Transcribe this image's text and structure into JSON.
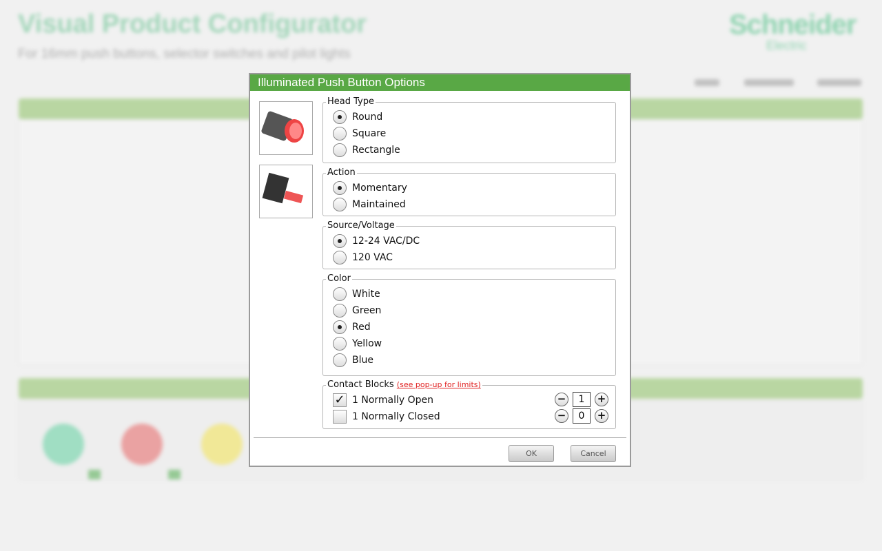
{
  "background": {
    "title": "Visual Product Configurator",
    "subtitle": "For 16mm push buttons, selector switches and pilot lights",
    "logo": "Schneider Electric"
  },
  "dialog": {
    "title": "Illuminated Push Button Options",
    "images": [
      "push-button-head-image",
      "contact-block-image"
    ],
    "head_type": {
      "legend": "Head Type",
      "options": [
        "Round",
        "Square",
        "Rectangle"
      ],
      "selected": "Round"
    },
    "action": {
      "legend": "Action",
      "options": [
        "Momentary",
        "Maintained"
      ],
      "selected": "Momentary"
    },
    "source_voltage": {
      "legend": "Source/Voltage",
      "options": [
        "12-24 VAC/DC",
        "120 VAC"
      ],
      "selected": "12-24 VAC/DC"
    },
    "color": {
      "legend": "Color",
      "options": [
        "White",
        "Green",
        "Red",
        "Yellow",
        "Blue"
      ],
      "selected": "Red"
    },
    "contact_blocks": {
      "legend": "Contact Blocks",
      "link": "(see pop-up for limits)",
      "items": [
        {
          "label": "1 Normally Open",
          "checked": true,
          "qty": "1"
        },
        {
          "label": "1 Normally Closed",
          "checked": false,
          "qty": "0"
        }
      ]
    },
    "ok_label": "OK",
    "cancel_label": "Cancel"
  },
  "colors": {
    "header_green": "#59a845",
    "link_red": "#e02020"
  }
}
